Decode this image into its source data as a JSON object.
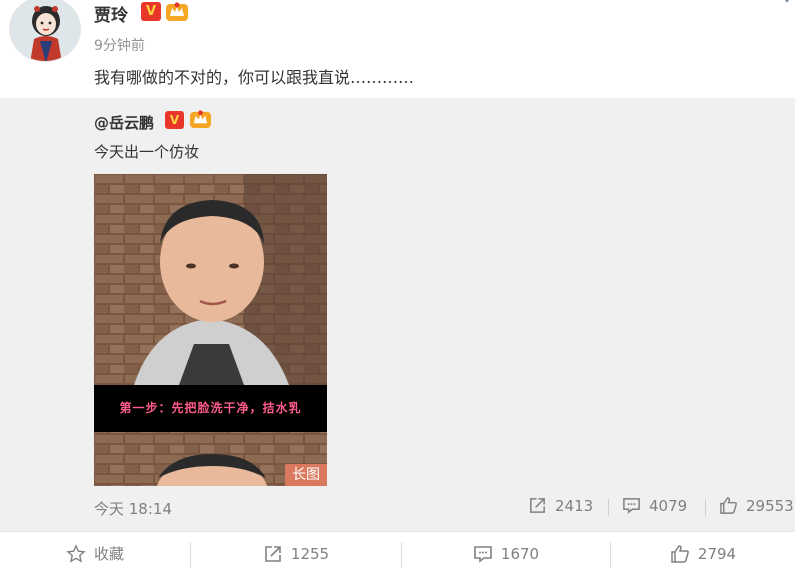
{
  "post": {
    "author": "贾玲",
    "verified_badge": "V",
    "time": "9分钟前",
    "text": "我有哪做的不对的，你可以跟我直说…………"
  },
  "repost": {
    "author": "@岳云鹏",
    "verified_badge": "V",
    "text": "今天出一个仿妆",
    "image": {
      "caption": "第一步：先把脸洗干净，拮水乳",
      "tag": "长图"
    },
    "time": "今天 18:14",
    "reposts": "2413",
    "comments": "4079",
    "likes": "29553"
  },
  "actions": {
    "favorite_label": "收藏",
    "repost_count": "1255",
    "comment_count": "1670",
    "like_count": "2794"
  },
  "colors": {
    "accent_red": "#e8372a",
    "repost_bg": "#f0f0f0",
    "meta_gray": "#808080"
  }
}
